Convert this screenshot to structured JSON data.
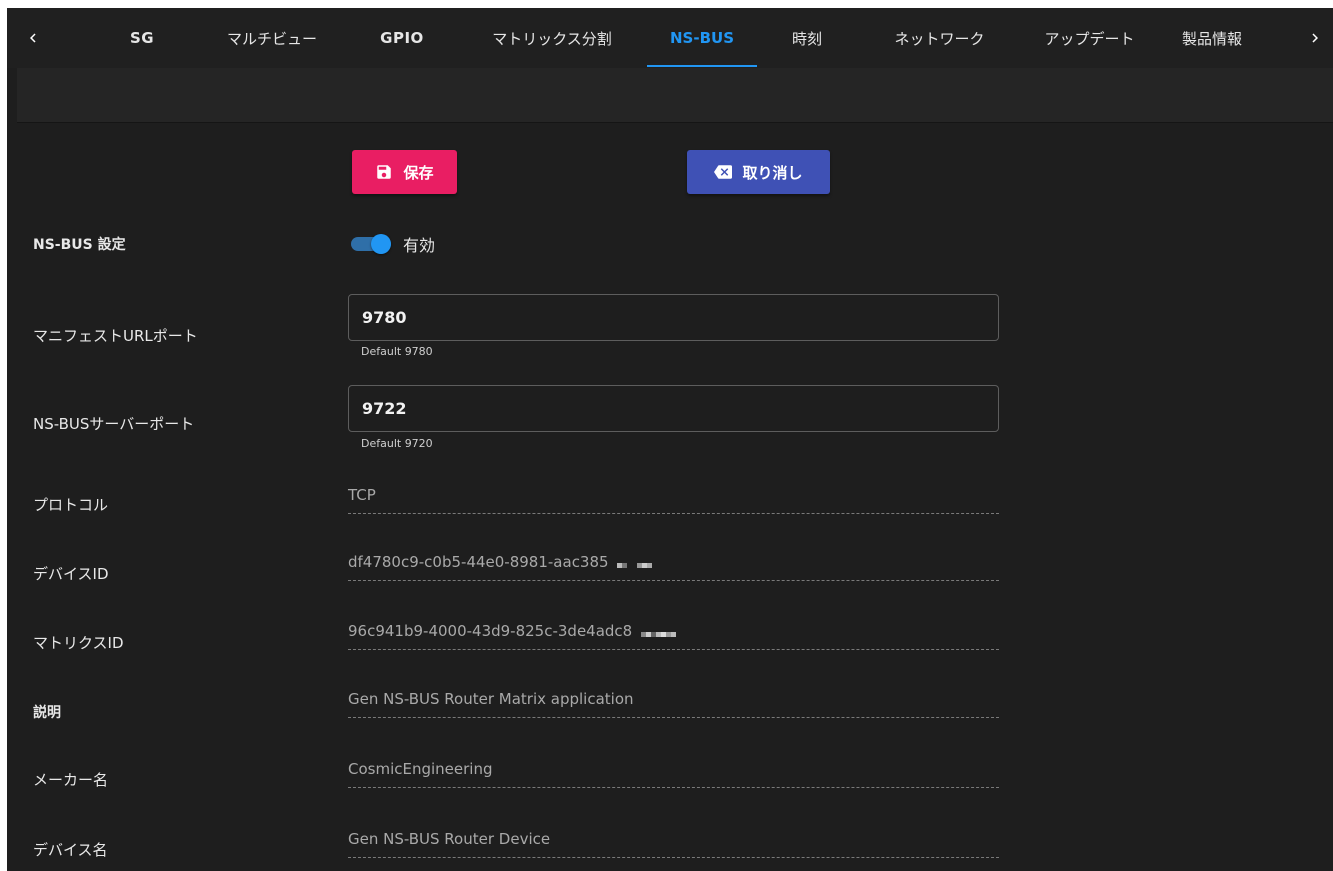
{
  "nav": {
    "tabs": [
      {
        "label": "SG"
      },
      {
        "label": "マルチビュー"
      },
      {
        "label": "GPIO"
      },
      {
        "label": "マトリックス分割"
      },
      {
        "label": "NS-BUS"
      },
      {
        "label": "時刻"
      },
      {
        "label": "ネットワーク"
      },
      {
        "label": "アップデート"
      },
      {
        "label": "製品情報"
      }
    ],
    "active_tab": "NS-BUS",
    "accent_color": "#2196f3"
  },
  "toolbar": {
    "save_label": "保存",
    "save_color": "#e91e63",
    "cancel_label": "取り消し",
    "cancel_color": "#3f51b5"
  },
  "form": {
    "nsbus_setting": {
      "label": "NS-BUS 設定",
      "toggle_label": "有効",
      "enabled": true
    },
    "manifest_port": {
      "label": "マニフェストURLポート",
      "value": "9780",
      "hint": "Default 9780"
    },
    "server_port": {
      "label": "NS-BUSサーバーポート",
      "value": "9722",
      "hint": "Default 9720"
    },
    "protocol": {
      "label": "プロトコル",
      "value": "TCP"
    },
    "device_id": {
      "label": "デバイスID",
      "value": "df4780c9-c0b5-44e0-8981-aac385"
    },
    "matrix_id": {
      "label": "マトリクスID",
      "value": "96c941b9-4000-43d9-825c-3de4adc8"
    },
    "description": {
      "label": "説明",
      "value": "Gen NS-BUS Router Matrix application"
    },
    "maker": {
      "label": "メーカー名",
      "value": "CosmicEngineering"
    },
    "device_name": {
      "label": "デバイス名",
      "value": "Gen NS-BUS Router Device"
    }
  }
}
